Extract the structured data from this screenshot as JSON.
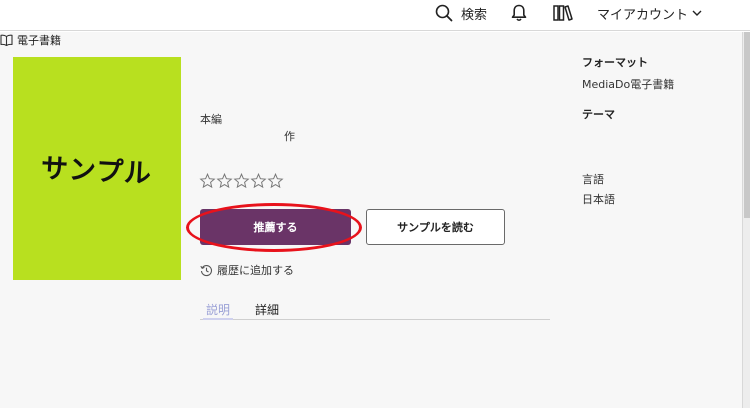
{
  "header": {
    "search_label": "検索",
    "account_label": "マイアカウント"
  },
  "book": {
    "cover_text": "サンプル",
    "type_label": "本編",
    "author_label": "作",
    "format_label": "電子書籍",
    "rating": 0,
    "rating_max": 5
  },
  "actions": {
    "recommend_label": "推薦する",
    "sample_label": "サンプルを読む",
    "history_label": "履歴に追加する"
  },
  "tabs": [
    {
      "label": "説明"
    },
    {
      "label": "詳細"
    }
  ],
  "sidebar": {
    "format_heading": "フォーマット",
    "format_value": "MediaDo電子書籍",
    "theme_heading": "テーマ",
    "language_heading": "言語",
    "language_value": "日本語"
  },
  "colors": {
    "primary": "#6a3467",
    "cover": "#b8e01f",
    "highlight": "#e8121b",
    "tab_active": "#9aa0d6"
  }
}
